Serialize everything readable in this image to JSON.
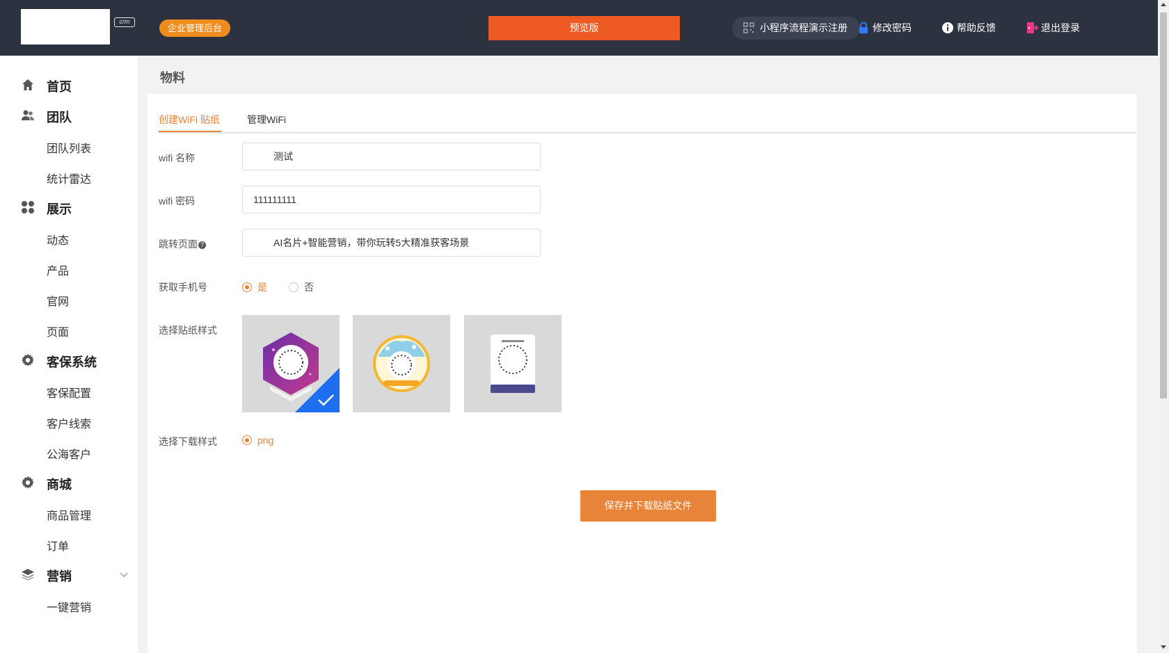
{
  "header": {
    "logo_badge": "crm",
    "admin_badge": "企业管理后台",
    "preview_label": "预览版",
    "mini_program_label": "小程序流程演示注册",
    "change_password": "修改密码",
    "help_feedback": "帮助反馈",
    "logout": "退出登录"
  },
  "sidebar": {
    "groups": [
      {
        "label": "首页",
        "icon": "home-icon"
      },
      {
        "label": "团队",
        "icon": "team-icon",
        "children": [
          "团队列表",
          "统计雷达"
        ]
      },
      {
        "label": "展示",
        "icon": "grid-icon",
        "children": [
          "动态",
          "产品",
          "官网",
          "页面"
        ]
      },
      {
        "label": "客保系统",
        "icon": "gear-icon",
        "children": [
          "客保配置",
          "客户线索",
          "公海客户"
        ]
      },
      {
        "label": "商城",
        "icon": "gear-icon",
        "children": [
          "商品管理",
          "订单"
        ]
      },
      {
        "label": "营销",
        "icon": "layers-icon",
        "children": [
          "一键营销"
        ]
      }
    ]
  },
  "main": {
    "page_title": "物料",
    "tabs": [
      {
        "label": "创建WiFi 贴纸",
        "active": true
      },
      {
        "label": "管理WiFi",
        "active": false
      }
    ],
    "form": {
      "wifi_name_label": "wifi 名称",
      "wifi_name_value": "测试",
      "wifi_password_label": "wifi 密码",
      "wifi_password_value": "111111111",
      "redirect_label": "跳转页面",
      "redirect_help": "?",
      "redirect_value": "AI名片+智能营销，带你玩转5大精准获客场景",
      "phone_label": "获取手机号",
      "phone_options": [
        "是",
        "否"
      ],
      "phone_selected": "是",
      "sticker_label": "选择贴纸样式",
      "sticker_selected_index": 0,
      "download_label": "选择下载样式",
      "download_option": "png",
      "save_button": "保存并下载贴纸文件"
    }
  },
  "colors": {
    "topbar": "#2c3240",
    "accent": "#e8833a",
    "preview": "#ee5a24",
    "admin_badge": "#f08c1c",
    "selected_check": "#1e6ff0"
  }
}
